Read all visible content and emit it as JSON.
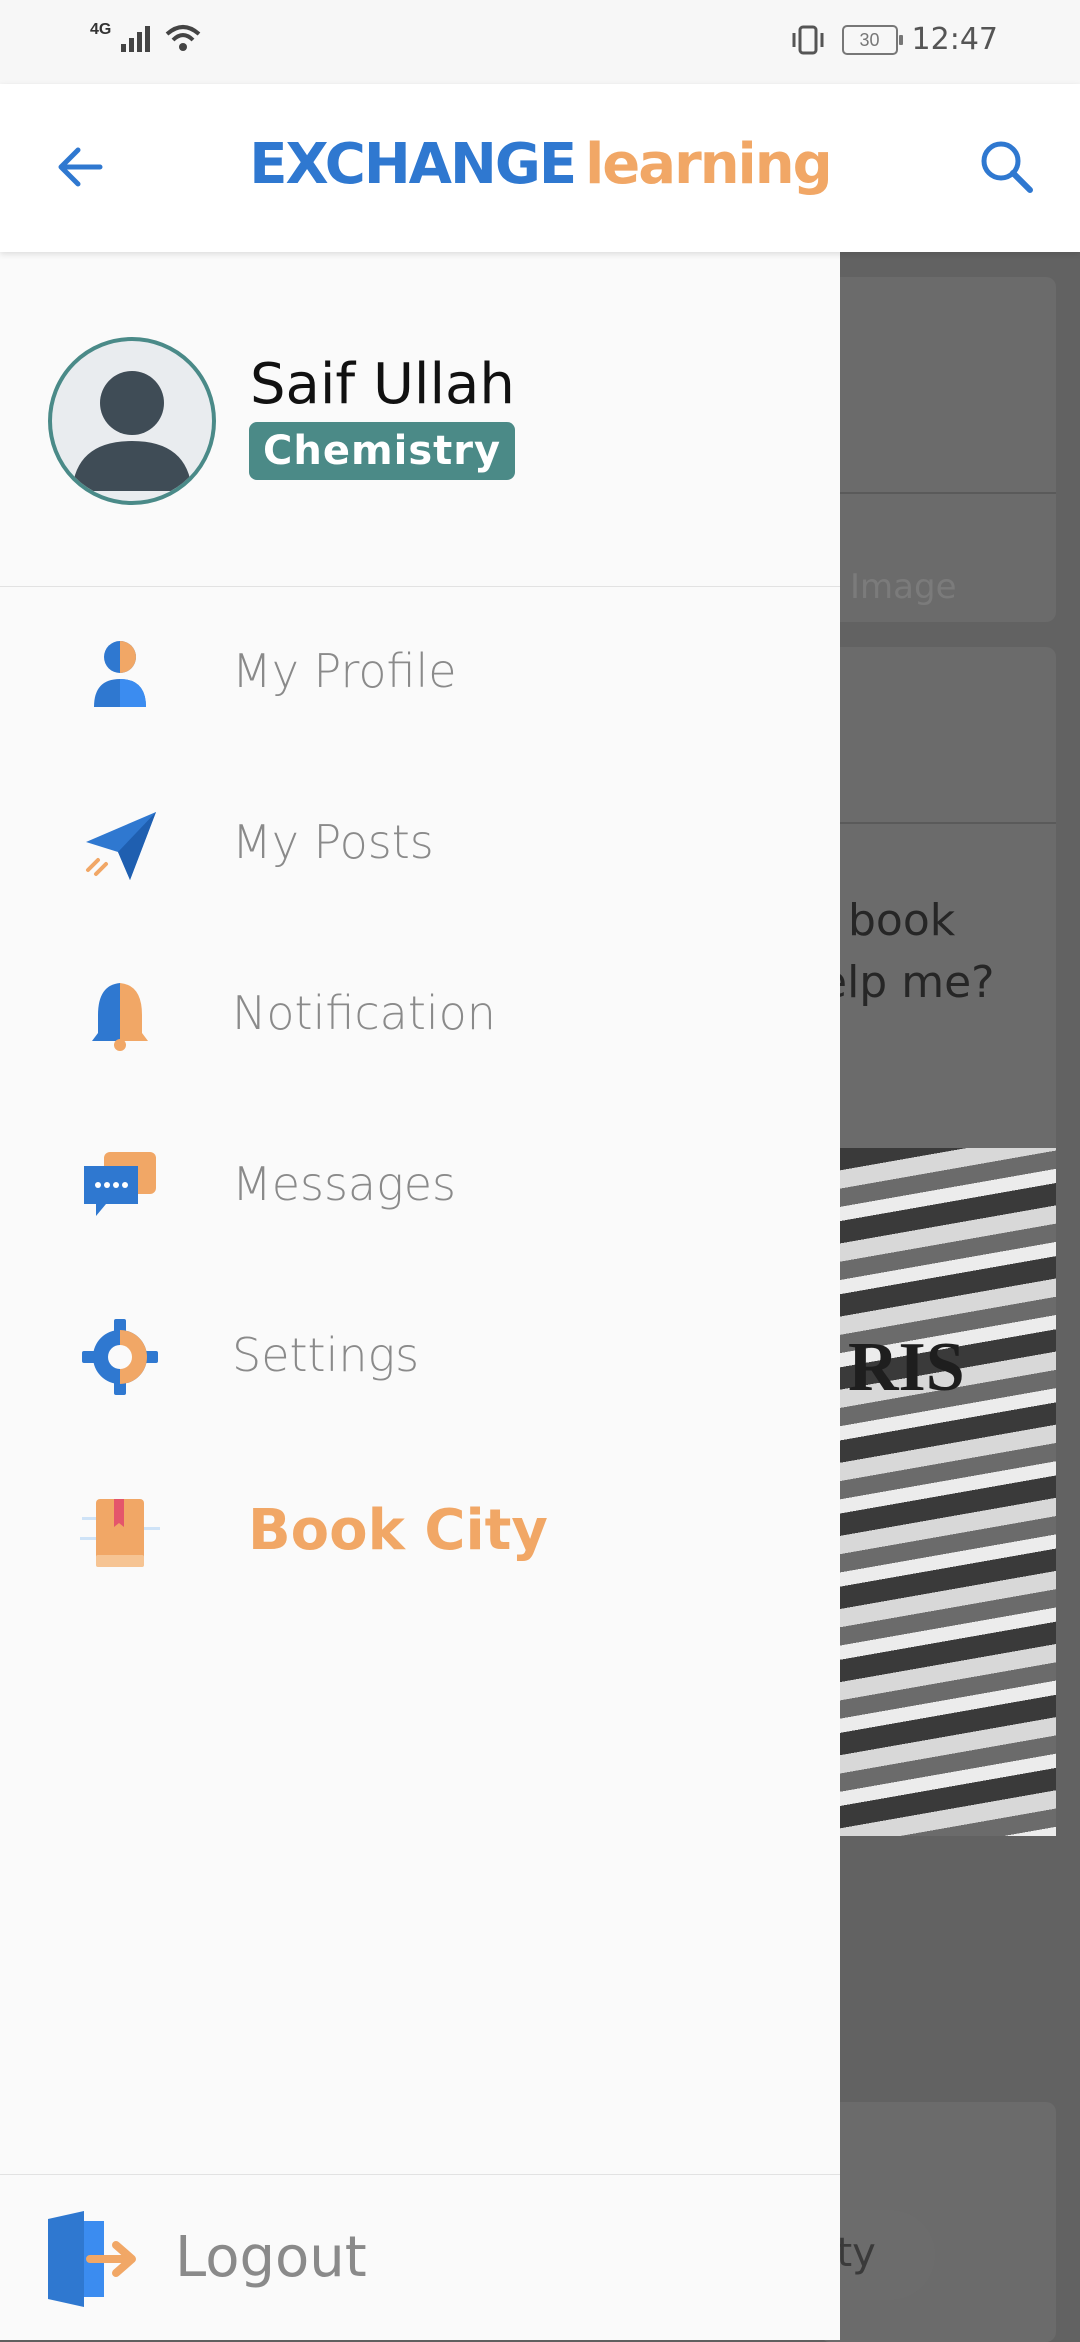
{
  "status_bar": {
    "network": "4G",
    "battery": "30",
    "time": "12:47"
  },
  "app_bar": {
    "logo_part1": "EXCHANGE",
    "logo_part2": "learning"
  },
  "drawer": {
    "user": {
      "name": "Saif Ullah",
      "subject": "Chemistry"
    },
    "menu": [
      {
        "label": "My Profile",
        "icon": "profile-icon"
      },
      {
        "label": "My Posts",
        "icon": "paper-plane-icon"
      },
      {
        "label": "Notification",
        "icon": "bell-icon"
      },
      {
        "label": "Messages",
        "icon": "chat-icon"
      },
      {
        "label": "Settings",
        "icon": "gear-icon"
      },
      {
        "label": "Book City",
        "icon": "book-icon"
      }
    ],
    "logout_label": "Logout"
  },
  "background": {
    "image_hint": "Image",
    "post_text_line1": "book",
    "post_text_line2": "elp me?",
    "pill_text": "nity"
  },
  "colors": {
    "accent_blue": "#2f78d0",
    "accent_orange": "#f1a766",
    "badge_teal": "#4b8a87"
  }
}
